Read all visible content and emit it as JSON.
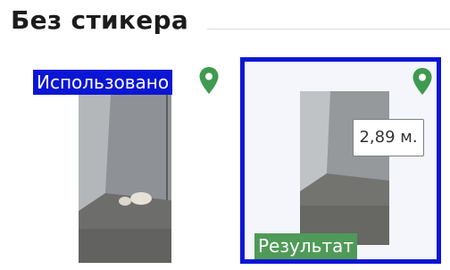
{
  "section": {
    "title": "Без стикера"
  },
  "photo_card": {
    "badge_label": "Использовано",
    "pin_icon": "map-pin-icon"
  },
  "result_card": {
    "distance_label": "2,89 м.",
    "badge_label": "Результат",
    "pin_icon": "map-pin-icon",
    "selected": true
  },
  "colors": {
    "selection_border": "#0b16d4",
    "used_badge": "#0b16d4",
    "result_badge": "#4f9a58",
    "pin": "#3f9a4f"
  }
}
